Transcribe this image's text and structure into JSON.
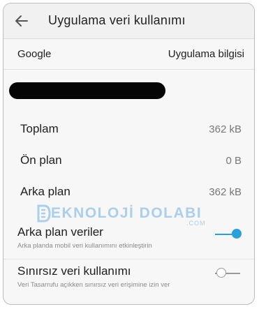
{
  "header": {
    "title": "Uygulama veri kullanımı",
    "back_icon": "arrow-left-icon"
  },
  "app": {
    "name": "Google",
    "info_link": "Uygulama bilgisi"
  },
  "stats": [
    {
      "label": "Toplam",
      "value": "362 kB"
    },
    {
      "label": "Ön plan",
      "value": "0 B"
    },
    {
      "label": "Arka plan",
      "value": "362 kB"
    }
  ],
  "settings": {
    "background_data": {
      "title": "Arka plan veriler",
      "subtitle": "Arka planda mobil veri kullanımını etkinleştirin",
      "enabled": true
    },
    "unrestricted_data": {
      "title": "Sınırsız veri kullanımı",
      "subtitle": "Veri Tasarrufu açıkken sınırsız veri erişimine izin ver",
      "enabled": false
    }
  },
  "watermark": {
    "logo_text": "EKNOLOJİ DOLABI",
    "domain_text": ".COM"
  },
  "colors": {
    "accent": "#2b9fd8",
    "background": "#f7f7f7",
    "watermark": "#aacfea"
  }
}
